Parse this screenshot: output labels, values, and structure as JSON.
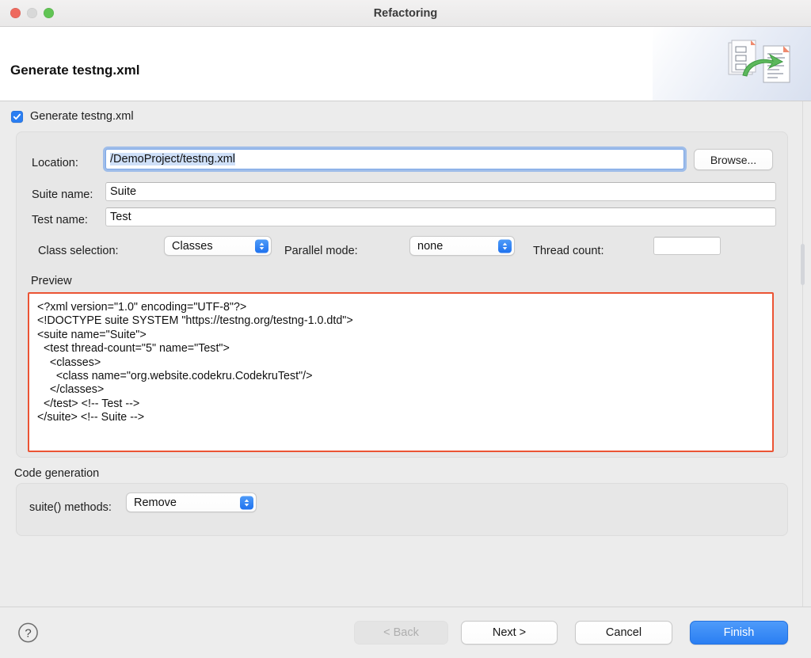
{
  "window": {
    "title": "Refactoring",
    "traffic_lights": [
      "close",
      "minimize",
      "zoom"
    ]
  },
  "banner": {
    "heading": "Generate testng.xml",
    "icon": "refactoring-documents-icon"
  },
  "options": {
    "generate_checkbox_label": "Generate testng.xml",
    "generate_checkbox_checked": "true"
  },
  "form": {
    "location_label": "Location:",
    "location_value": "/DemoProject/testng.xml",
    "browse_label": "Browse...",
    "suite_name_label": "Suite name:",
    "suite_name_value": "Suite",
    "test_name_label": "Test name:",
    "test_name_value": "Test",
    "class_selection_label": "Class selection:",
    "class_selection_value": "Classes",
    "parallel_mode_label": "Parallel mode:",
    "parallel_mode_value": "none",
    "thread_count_label": "Thread count:",
    "thread_count_value": ""
  },
  "preview": {
    "label": "Preview",
    "text": "<?xml version=\"1.0\" encoding=\"UTF-8\"?>\n<!DOCTYPE suite SYSTEM \"https://testng.org/testng-1.0.dtd\">\n<suite name=\"Suite\">\n  <test thread-count=\"5\" name=\"Test\">\n    <classes>\n      <class name=\"org.website.codekru.CodekruTest\"/>\n    </classes>\n  </test> <!-- Test -->\n</suite> <!-- Suite -->",
    "border_color": "#eb5434"
  },
  "code_generation": {
    "label": "Code generation",
    "suite_methods_label": "suite() methods:",
    "suite_methods_value": "Remove"
  },
  "footer": {
    "help_label": "?",
    "back_label": "< Back",
    "back_disabled": "true",
    "next_label": "Next >",
    "cancel_label": "Cancel",
    "finish_label": "Finish",
    "finish_accent": "#2a7ef2"
  }
}
